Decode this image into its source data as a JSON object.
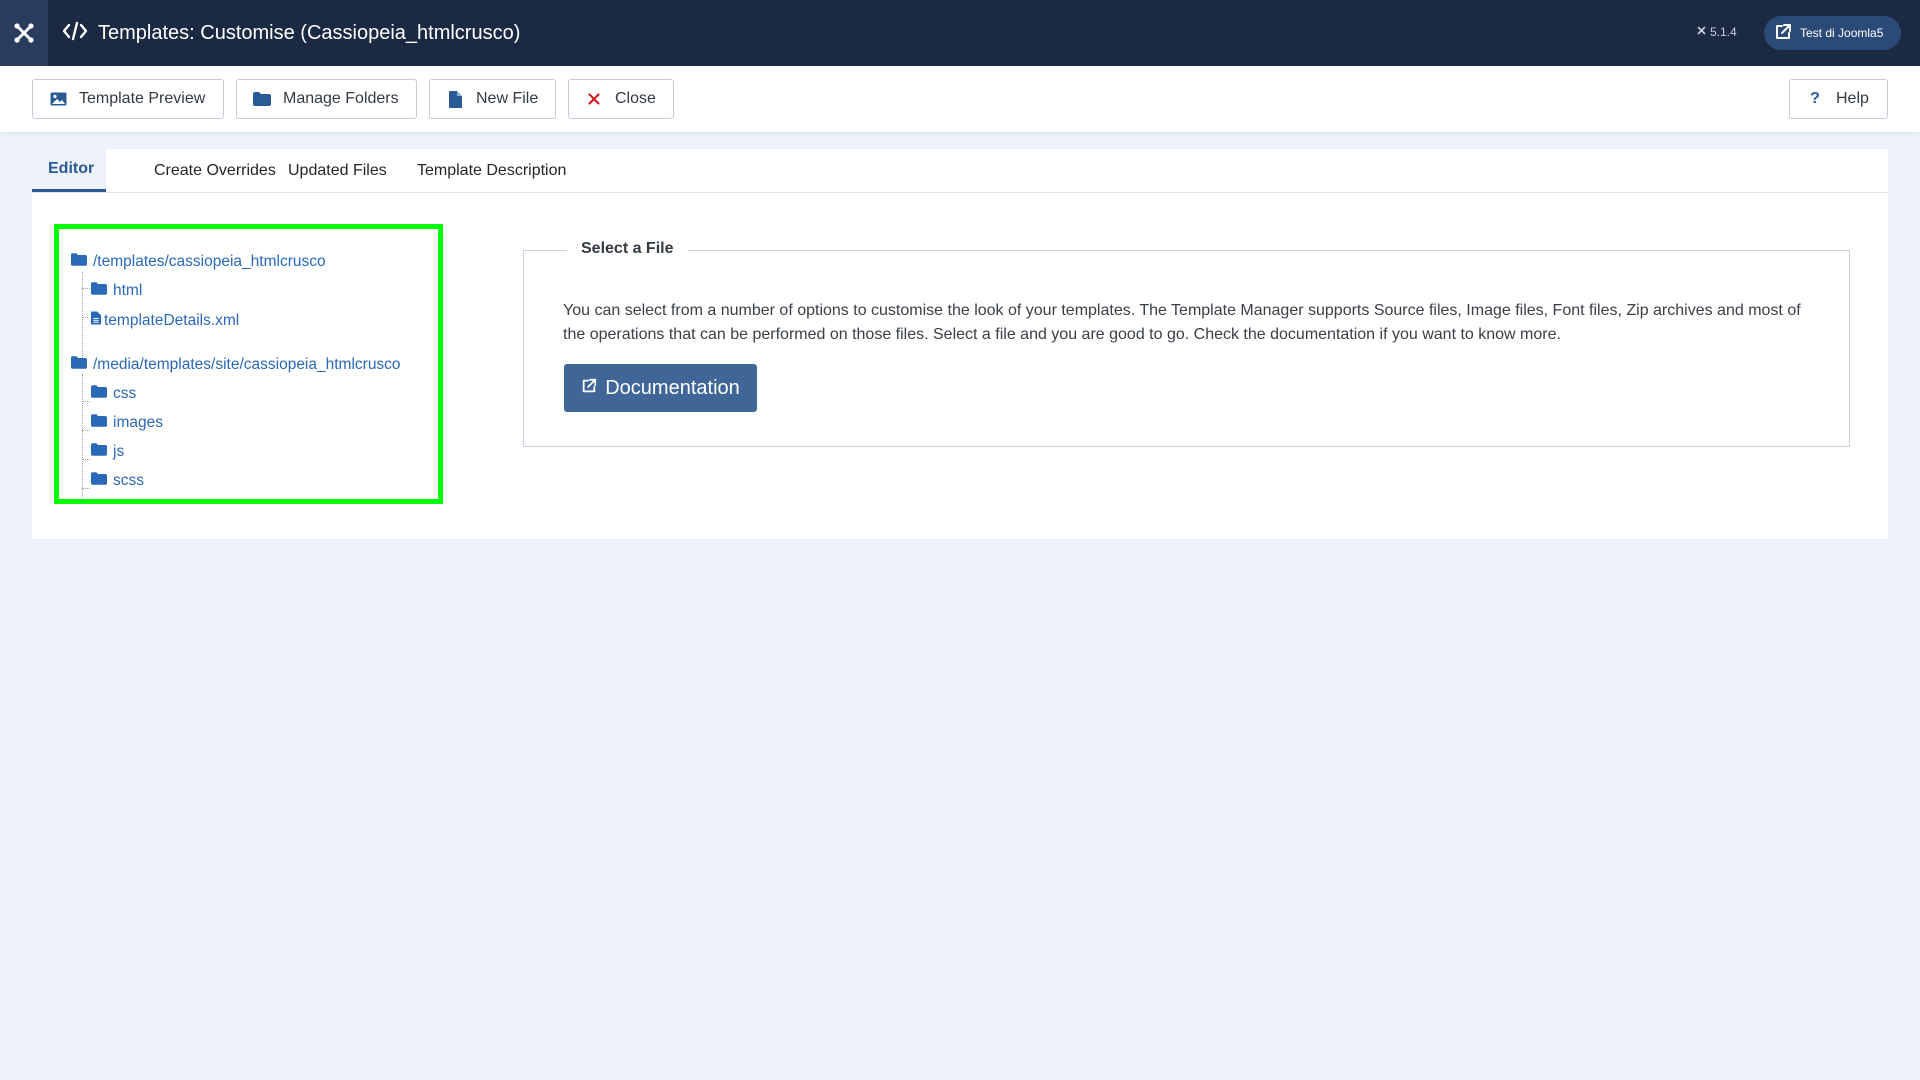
{
  "header": {
    "title": "Templates: Customise (Cassiopeia_htmlcrusco)",
    "version": "5.1.4",
    "site_button": "Test di Joomla5",
    "logo_icon": "joomla-logo-icon",
    "title_icon": "code-icon"
  },
  "toolbar": {
    "buttons": [
      {
        "label": "Template Preview",
        "icon": "image-icon"
      },
      {
        "label": "Manage Folders",
        "icon": "folder-icon"
      },
      {
        "label": "New File",
        "icon": "file-icon"
      },
      {
        "label": "Close",
        "icon": "close-icon"
      }
    ],
    "help": {
      "label": "Help",
      "icon": "question-icon"
    }
  },
  "tabs": [
    "Editor",
    "Create Overrides",
    "Updated Files",
    "Template Description"
  ],
  "active_tab": "Editor",
  "tree": {
    "root1": "/templates/cassiopeia_htmlcrusco",
    "root1_children": [
      {
        "label": "html",
        "type": "folder"
      },
      {
        "label": "templateDetails.xml",
        "type": "file"
      }
    ],
    "root2": "/media/templates/site/cassiopeia_htmlcrusco",
    "root2_children": [
      {
        "label": "css",
        "type": "folder"
      },
      {
        "label": "images",
        "type": "folder"
      },
      {
        "label": "js",
        "type": "folder"
      },
      {
        "label": "scss",
        "type": "folder"
      }
    ]
  },
  "select_file": {
    "legend": "Select a File",
    "text": "You can select from a number of options to customise the look of your templates. The Template Manager supports Source files, Image files, Font files, Zip archives and most of the operations that can be performed on those files. Select a file and you are good to go. Check the documentation if you want to know more.",
    "button": "Documentation"
  },
  "colors": {
    "header_bg": "#1b2943",
    "link": "#2a69b8",
    "primary_button": "#3f6696",
    "highlight_border": "#00ff00",
    "close_red": "#d1101a"
  }
}
